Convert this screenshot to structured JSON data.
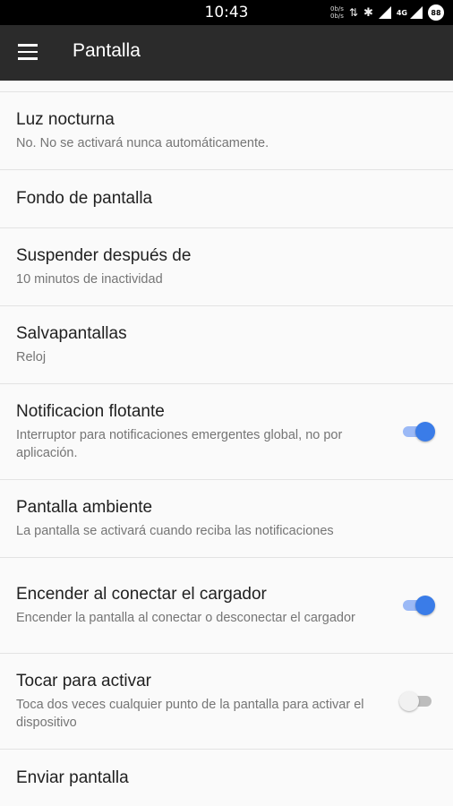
{
  "status_bar": {
    "time": "10:43",
    "speed_up": "0b/s",
    "speed_down": "0b/s",
    "network": "4G",
    "battery": "88"
  },
  "app_bar": {
    "title": "Pantalla"
  },
  "settings": [
    {
      "title": "Luz nocturna",
      "summary": "No. No se activará nunca automáticamente."
    },
    {
      "title": "Fondo de pantalla"
    },
    {
      "title": "Suspender después de",
      "summary": "10 minutos de inactividad"
    },
    {
      "title": "Salvapantallas",
      "summary": "Reloj"
    },
    {
      "title": "Notificacion flotante",
      "summary": "Interruptor para notificaciones emergentes global, no por aplicación.",
      "toggle": true
    },
    {
      "title": "Pantalla ambiente",
      "summary": "La pantalla se activará cuando reciba las notificaciones"
    },
    {
      "title": "Encender al conectar el cargador",
      "summary": "Encender la pantalla al conectar o desconectar el cargador",
      "toggle": true
    },
    {
      "title": "Tocar para activar",
      "summary": "Toca dos veces cualquier punto de la pantalla para activar el dispositivo",
      "toggle": false
    },
    {
      "title": "Enviar pantalla"
    }
  ],
  "colors": {
    "app_bar": "#2b2b2b",
    "accent": "#3a7ce8",
    "background": "#fafafa"
  }
}
